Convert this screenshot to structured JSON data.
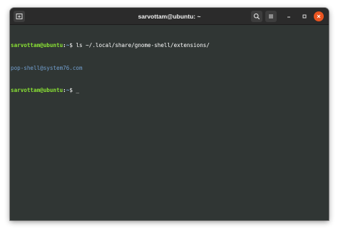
{
  "window": {
    "title": "sarvottam@ubuntu: ~"
  },
  "titlebar": {
    "icons": [
      "new-tab-icon",
      "search-icon",
      "hamburger-menu-icon",
      "minimize-icon",
      "maximize-icon",
      "close-icon"
    ]
  },
  "terminal": {
    "lines": [
      {
        "user_host": "sarvottam@ubuntu",
        "colon": ":",
        "path": "~",
        "prompt_char": "$ ",
        "command": "ls ~/.local/share/gnome-shell/extensions/"
      },
      {
        "output": "pop-shell@system76.com"
      },
      {
        "user_host": "sarvottam@ubuntu",
        "colon": ":",
        "path": "~",
        "prompt_char": "$ ",
        "command": "",
        "cursor": "_"
      }
    ]
  },
  "colors": {
    "terminal_bg": "#303634",
    "titlebar_bg": "#2b2b2b",
    "prompt_user": "#8ae234",
    "prompt_path": "#729fcf",
    "close_button": "#e95420"
  }
}
